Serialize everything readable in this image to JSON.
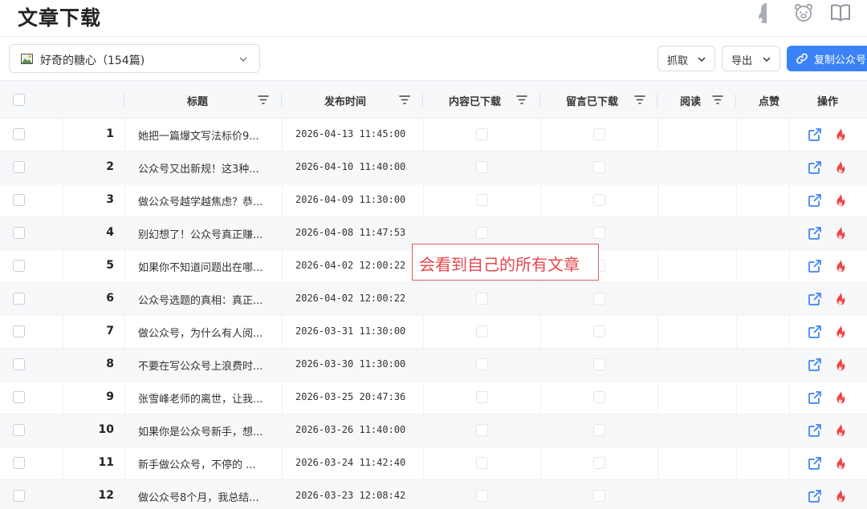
{
  "header": {
    "title": "文章下载"
  },
  "toolbar": {
    "account_label": "好奇的糖心（154篇)",
    "fetch_label": "抓取",
    "export_label": "导出",
    "copy_label": "复制公众号"
  },
  "table": {
    "columns": {
      "title": "标题",
      "publish_time": "发布时间",
      "content_downloaded": "内容已下载",
      "comments_downloaded": "留言已下载",
      "reads": "阅读",
      "likes": "点赞",
      "actions": "操作"
    },
    "rows": [
      {
        "index": "1",
        "title": "她把一篇爆文写法标价9...",
        "time": "2026-04-13 11:45:00"
      },
      {
        "index": "2",
        "title": "公众号又出新规！这3种...",
        "time": "2026-04-10 11:40:00"
      },
      {
        "index": "3",
        "title": "做公众号越学越焦虑？恭...",
        "time": "2026-04-09 11:30:00"
      },
      {
        "index": "4",
        "title": "别幻想了！公众号真正赚...",
        "time": "2026-04-08 11:47:53"
      },
      {
        "index": "5",
        "title": "如果你不知道问题出在哪...",
        "time": "2026-04-02 12:00:22"
      },
      {
        "index": "6",
        "title": "公众号选题的真相：真正...",
        "time": "2026-04-02 12:00:22"
      },
      {
        "index": "7",
        "title": "做公众号，为什么有人阅...",
        "time": "2026-03-31 11:30:00"
      },
      {
        "index": "8",
        "title": "不要在写公众号上浪费时...",
        "time": "2026-03-30 11:30:00"
      },
      {
        "index": "9",
        "title": "张雪峰老师的离世，让我...",
        "time": "2026-03-25 20:47:36"
      },
      {
        "index": "10",
        "title": "如果你是公众号新手，想...",
        "time": "2026-03-26 11:40:00"
      },
      {
        "index": "11",
        "title": "新手做公众号，不停的 ...",
        "time": "2026-03-24 11:42:40"
      },
      {
        "index": "12",
        "title": "做公众号8个月，我总结...",
        "time": "2026-03-23 12:08:42"
      }
    ]
  },
  "annotation": {
    "text": "会看到自己的所有文章"
  },
  "colors": {
    "accent": "#3b82f6",
    "fire": "#ef4444",
    "note": "#e5484d"
  },
  "icons": [
    "qq-penguin-icon",
    "bear-icon",
    "book-icon",
    "image-icon",
    "chevron-down-icon",
    "link-icon",
    "filter-icon",
    "external-link-icon",
    "fire-icon"
  ]
}
